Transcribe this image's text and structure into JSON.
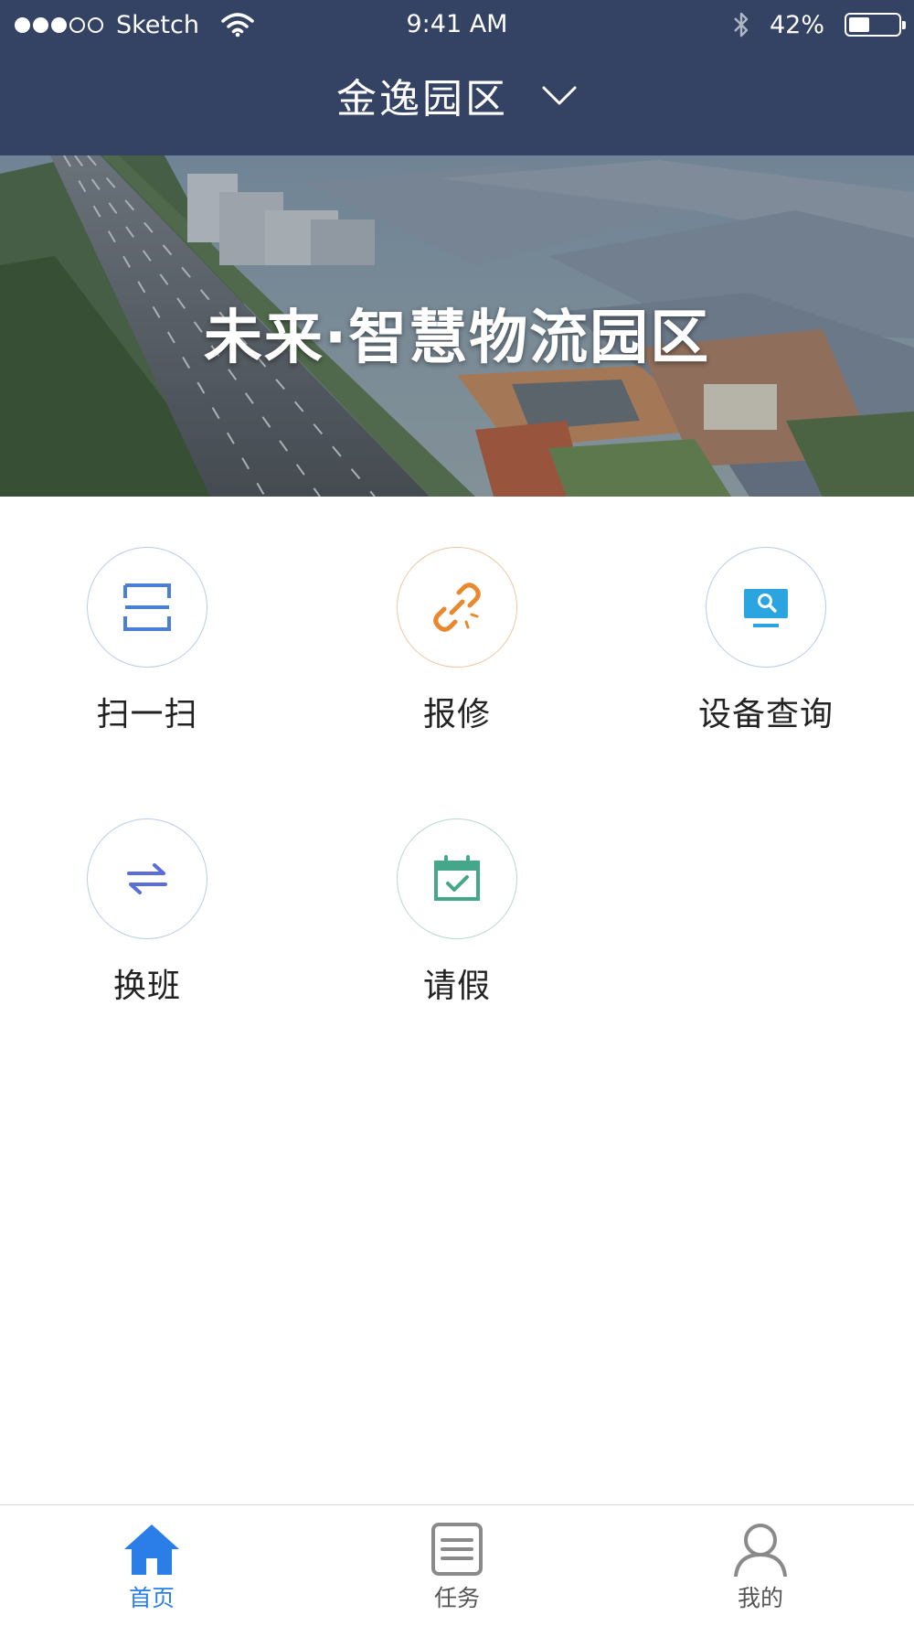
{
  "status_bar": {
    "carrier": "Sketch",
    "time": "9:41 AM",
    "battery_percent": "42%",
    "battery_level": 0.42,
    "signal_bars_filled": 3,
    "signal_bars_total": 5
  },
  "header": {
    "park_name": "金逸园区"
  },
  "banner": {
    "title": "未来·智慧物流园区"
  },
  "functions": [
    {
      "label": "扫一扫",
      "icon": "scan-icon"
    },
    {
      "label": "报修",
      "icon": "broken-link-icon"
    },
    {
      "label": "设备查询",
      "icon": "monitor-search-icon"
    },
    {
      "label": "换班",
      "icon": "swap-icon"
    },
    {
      "label": "请假",
      "icon": "calendar-check-icon"
    }
  ],
  "tab_bar": {
    "tabs": [
      {
        "label": "首页",
        "icon": "home-icon",
        "active": true
      },
      {
        "label": "任务",
        "icon": "task-list-icon",
        "active": false
      },
      {
        "label": "我的",
        "icon": "user-icon",
        "active": false
      }
    ]
  },
  "colors": {
    "header_bg": "#344263",
    "accent_blue": "#2b7ee8",
    "orange": "#e8892f",
    "green": "#45a78a",
    "icon_blue": "#4a7fd6",
    "swap_blue": "#5b6ed8",
    "cyan": "#2aa5e0"
  }
}
